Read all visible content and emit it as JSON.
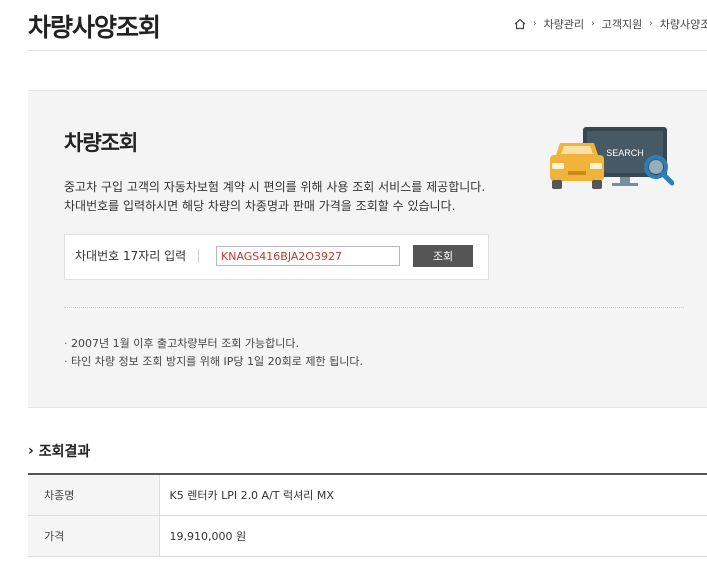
{
  "header": {
    "title": "차량사양조회",
    "breadcrumb": [
      "차량관리",
      "고객지원",
      "차량사양조"
    ]
  },
  "search": {
    "title": "차량조회",
    "description": [
      "중고차 구입 고객의 자동차보험 계약 시 편의를 위해 사용 조회 서비스를 제공합니다.",
      "차대번호를 입력하시면 해당 차량의 차종명과 판매 가격을 조회할 수 있습니다."
    ],
    "input_label": "차대번호 17자리 입력",
    "input_value": "KNAGS416BJA2O3927",
    "button_label": "조회",
    "notes": [
      "2007년 1월 이후 출고차량부터 조회 가능합니다.",
      "타인 차량 정보 조회 방지를 위해 IP당 1일 20회로 제한 됩니다."
    ],
    "illustration_text": "SEARCH"
  },
  "results": {
    "title": "조회결과",
    "rows": [
      {
        "label": "차종명",
        "value": "K5 렌터카 LPI 2.0 A/T 럭셔리 MX"
      },
      {
        "label": "가격",
        "value": "19,910,000 원"
      }
    ]
  },
  "colors": {
    "car": "#f2b33a",
    "monitor": "#37474f",
    "magnifier": "#2a7fb8",
    "input_text": "#c0392b"
  }
}
